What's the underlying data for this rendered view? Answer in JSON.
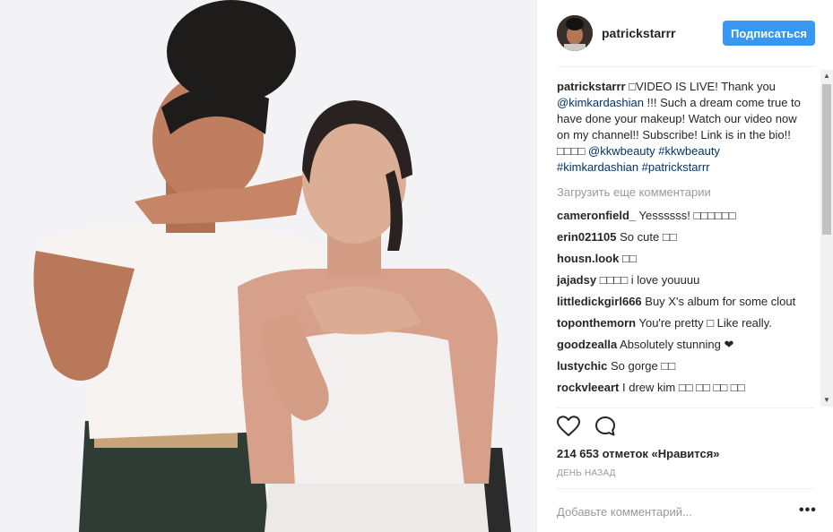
{
  "post": {
    "username": "patrickstarrr",
    "follow_label": "Подписаться"
  },
  "caption": {
    "username": "patrickstarrr",
    "text_1": " □VIDEO IS LIVE! Thank you ",
    "mention_1": "@kimkardashian",
    "text_2": " !!! Such a dream come true to have done your makeup! Watch our video now on my channel!! Subscribe! Link is in the bio!! □□□□ ",
    "mention_2": "@kkwbeauty",
    "hashtag_1": "#kkwbeauty",
    "hashtag_2": "#kimkardashian",
    "hashtag_3": "#patrickstarrr"
  },
  "load_more_label": "Загрузить еще комментарии",
  "comments": [
    {
      "user": "cameronfield_",
      "text": "Yessssss! □□□□□□"
    },
    {
      "user": "erin021105",
      "text": "So cute □□"
    },
    {
      "user": "housn.look",
      "text": "□□"
    },
    {
      "user": "jajadsy",
      "text": "□□□□ i love youuuu"
    },
    {
      "user": "littledickgirl666",
      "text": "Buy X's album for some clout"
    },
    {
      "user": "toponthemorn",
      "text": "You're pretty □ Like really."
    },
    {
      "user": "goodzealla",
      "text": "Absolutely stunning ❤"
    },
    {
      "user": "lustychic",
      "text": "So gorge □□"
    },
    {
      "user": "rockvleeart",
      "text": "I drew kim □□ □□ □□ □□"
    }
  ],
  "likes_label": "214 653 отметок «Нравится»",
  "time_label": "ДЕНЬ НАЗАД",
  "add_comment_placeholder": "Добавьте комментарий...",
  "more_options_label": "•••",
  "icons": {
    "like": "heart-icon",
    "comment": "comment-bubble-icon",
    "scroll_up": "scroll-up-arrow-icon",
    "scroll_down": "scroll-down-arrow-icon"
  },
  "colors": {
    "follow_button": "#3897f0",
    "link": "#003569",
    "muted": "#999999"
  }
}
